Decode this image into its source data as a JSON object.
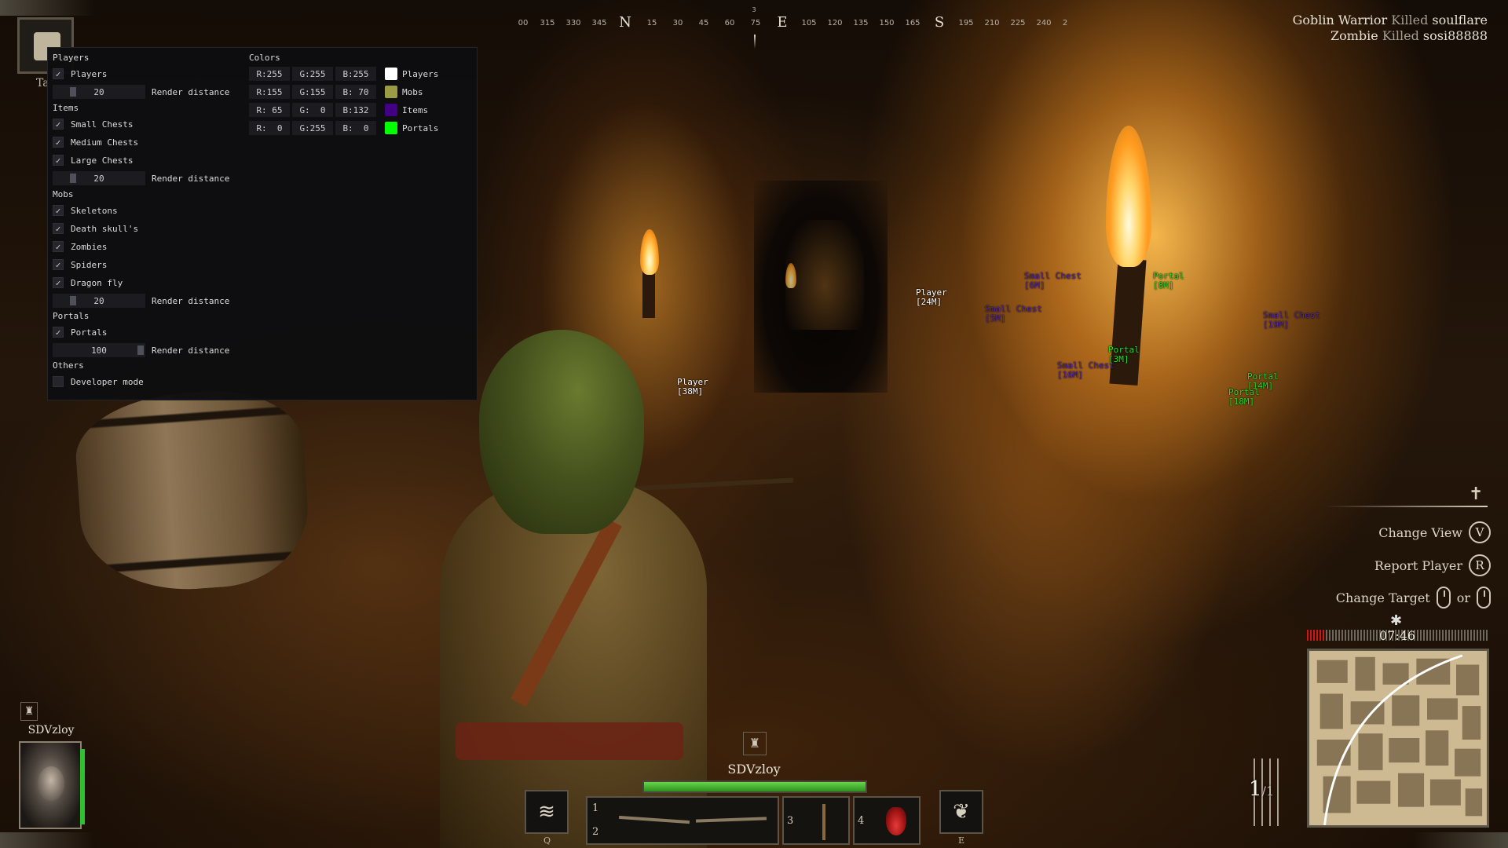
{
  "menu": {
    "players_section": "Players",
    "players_check": "Players",
    "players_distance": "20",
    "items_section": "Items",
    "small_chests": "Small Chests",
    "medium_chests": "Medium Chests",
    "large_chests": "Large Chests",
    "items_distance": "20",
    "mobs_section": "Mobs",
    "skeletons": "Skeletons",
    "death_skulls": "Death skull's",
    "zombies": "Zombies",
    "spiders": "Spiders",
    "dragon_fly": "Dragon fly",
    "mobs_distance": "20",
    "portals_section": "Portals",
    "portals_check": "Portals",
    "portals_distance": "100",
    "others_section": "Others",
    "developer_mode": "Developer mode",
    "render_distance_label": "Render distance",
    "check_glyph": "✓",
    "colors_section": "Colors",
    "colors": [
      {
        "r": "R:255",
        "g": "G:255",
        "b": "B:255",
        "label": "Players",
        "swatch": "#ffffff"
      },
      {
        "r": "R:155",
        "g": "G:155",
        "b": "B: 70",
        "label": "Mobs",
        "swatch": "#9b9b46"
      },
      {
        "r": "R: 65",
        "g": "G:  0",
        "b": "B:132",
        "label": "Items",
        "swatch": "#410084"
      },
      {
        "r": "R:  0",
        "g": "G:255",
        "b": "B:  0",
        "label": "Portals",
        "swatch": "#00ff00"
      }
    ]
  },
  "compass": {
    "ticks": [
      "00",
      "315",
      "330",
      "345",
      "N",
      "15",
      "30",
      "45",
      "60",
      "75",
      "E",
      "105",
      "120",
      "135",
      "150",
      "165",
      "S",
      "195",
      "210",
      "225",
      "240",
      "2"
    ],
    "marker": "3"
  },
  "esp": [
    {
      "kind": "player",
      "name": "Player",
      "dist": "[24M]"
    },
    {
      "kind": "player",
      "name": "Player",
      "dist": "[38M]"
    },
    {
      "kind": "item",
      "name": "Small Chest",
      "dist": "[6M]"
    },
    {
      "kind": "item",
      "name": "Small Chest",
      "dist": "[5M]"
    },
    {
      "kind": "item",
      "name": "Small Chest",
      "dist": "[19M]"
    },
    {
      "kind": "item",
      "name": "Small Chest",
      "dist": "[16M]"
    },
    {
      "kind": "portal",
      "name": "Portal",
      "dist": "[8M]"
    },
    {
      "kind": "portal",
      "name": "Portal",
      "dist": "[3M]"
    },
    {
      "kind": "portal",
      "name": "Portal",
      "dist": "[14M]"
    },
    {
      "kind": "portal",
      "name": "Portal",
      "dist": "[18M]"
    }
  ],
  "killfeed": [
    {
      "killer": "Goblin Warrior",
      "verb": "Killed",
      "victim": "soulflare"
    },
    {
      "killer": "Zombie",
      "verb": "Killed",
      "victim": "sosi88888"
    }
  ],
  "prompts": {
    "change_view": "Change View",
    "change_view_key": "V",
    "report_player": "Report Player",
    "report_player_key": "R",
    "change_target": "Change Target",
    "or": "or"
  },
  "timer": {
    "text": "07:46",
    "remaining_fraction": 0.1
  },
  "player": {
    "name": "SDVzloy",
    "hp_fraction": 1.0
  },
  "hotbar": {
    "skill_q_key": "Q",
    "skill_e_key": "E",
    "slot1": "1",
    "slot2": "2",
    "slot3": "3",
    "slot4": "4"
  },
  "ammo": {
    "current": "1",
    "max": "/1"
  },
  "tab_hint": "Ta",
  "colors": {
    "player_esp": "#ffffff",
    "item_esp": "#5b2aa8",
    "portal_esp": "#21e021",
    "hp_green": "#2fbf2f",
    "timer_red": "#d01616"
  }
}
